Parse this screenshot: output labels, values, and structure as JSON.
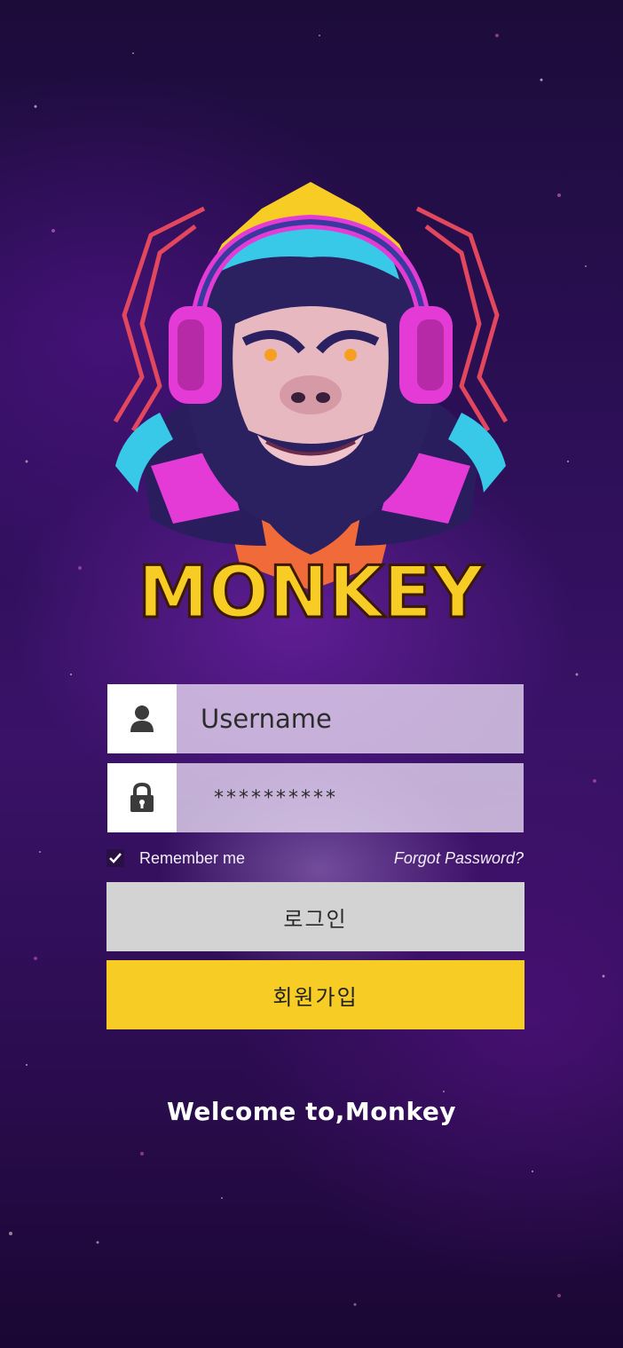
{
  "logo": {
    "brand_text": "MONKEY",
    "colors": {
      "primary": "#f7cc25",
      "accent": "#e53bd6",
      "fur": "#2b2060",
      "highlight": "#38c8e8"
    }
  },
  "login_form": {
    "username": {
      "icon": "user-icon",
      "placeholder": "Username"
    },
    "password": {
      "icon": "lock-icon",
      "value": "**********"
    },
    "remember_me": {
      "label": "Remember me",
      "checked": true
    },
    "forgot_password": "Forgot Password?",
    "login_button": "로그인",
    "signup_button": "회원가입"
  },
  "welcome_text": "Welcome to,Monkey",
  "colors": {
    "background": "#2b0f55",
    "login_button": "#d3d3d3",
    "signup_button": "#f7cc25"
  }
}
